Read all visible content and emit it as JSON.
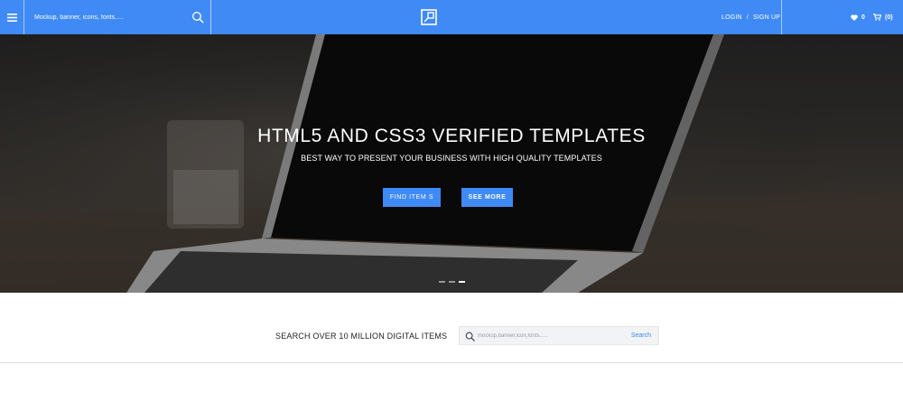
{
  "header": {
    "search_placeholder": "Mockup, banner, icons, fonts.....",
    "login_label": "LOGIN",
    "separator": "/",
    "signup_label": "SIGN UP",
    "wishlist_count": "0",
    "cart_count": "(0)"
  },
  "hero": {
    "title": "HTML5 AND CSS3 VERIFIED TEMPLATES",
    "subtitle": "BEST WAY TO PRESENT YOUR BUSINESS WITH HIGH QUALITY TEMPLATES",
    "primary_button": "FIND ITEM S",
    "secondary_button": "SEE MORE",
    "slides": 3,
    "active_slide": 3
  },
  "search_section": {
    "label": "SEARCH OVER 10 MILLION DIGITAL ITEMS",
    "placeholder": "mockup,banner,icon,fonts......",
    "button_label": "Search"
  },
  "colors": {
    "accent": "#3f8af5",
    "hero_dark": "#2b2b2b"
  }
}
